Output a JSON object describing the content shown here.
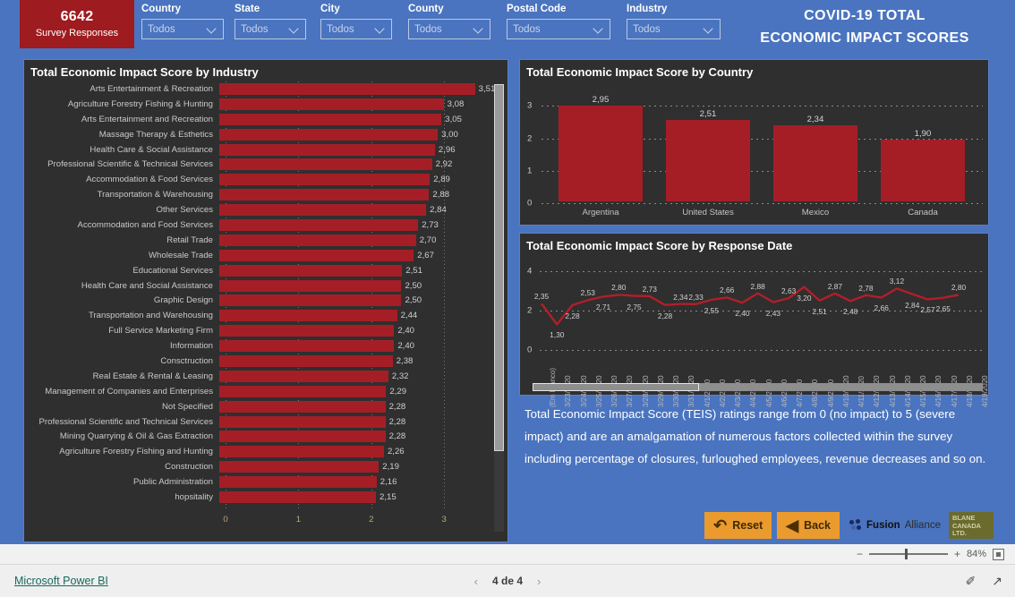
{
  "header": {
    "kpi": {
      "value": "6642",
      "label": "Survey Responses"
    },
    "slicers": [
      {
        "title": "Country",
        "value": "Todos",
        "icon": "chevron-down-icon"
      },
      {
        "title": "State",
        "value": "Todos",
        "icon": "chevron-down-icon"
      },
      {
        "title": "City",
        "value": "Todos",
        "icon": "chevron-down-icon"
      },
      {
        "title": "County",
        "value": "Todos",
        "icon": "chevron-down-icon"
      },
      {
        "title": "Postal Code",
        "value": "Todos",
        "icon": "chevron-down-icon"
      },
      {
        "title": "Industry",
        "value": "Todos",
        "icon": "chevron-down-icon"
      }
    ],
    "title_line1": "COVID-19 TOTAL",
    "title_line2": "ECONOMIC IMPACT SCORES"
  },
  "colors": {
    "canvas": "#4a74bf",
    "panel": "#2f2f2f",
    "bar": "#a51e26",
    "kpi": "#9e1b1f",
    "accent_button": "#eb9b2d"
  },
  "description": "Total Economic Impact Score (TEIS) ratings range from 0 (no impact) to 5 (severe impact) and are an amalgamation of numerous factors collected within the survey including percentage of closures, furloughed employees, revenue decreases and so on.",
  "actions": {
    "reset_label": "Reset",
    "reset_icon": "undo-arrow-icon",
    "back_label": "Back",
    "back_icon": "back-circle-arrow-icon",
    "fusion_name": "Fusion",
    "fusion_sub": "Alliance",
    "blane_line1": "BLANE",
    "blane_line2": "CANADA",
    "blane_line3": "LTD."
  },
  "zoombar": {
    "minus": "−",
    "plus": "+",
    "percent": "84%",
    "fit_icon": "fit-to-page-icon"
  },
  "statusbar": {
    "link": "Microsoft Power BI",
    "prev_icon": "chevron-left-icon",
    "next_icon": "chevron-right-icon",
    "page": "4 de 4",
    "icons": [
      {
        "name": "edit-page-icon",
        "glyph": "✐"
      },
      {
        "name": "fullscreen-icon",
        "glyph": "↗"
      }
    ]
  },
  "chart_data": [
    {
      "type": "bar",
      "title": "Total Economic Impact Score by Industry",
      "orientation": "horizontal",
      "xlabel": "",
      "ylabel": "",
      "xlim": [
        0,
        3.6
      ],
      "xticks": [
        "0",
        "1",
        "2",
        "3"
      ],
      "grid": true,
      "categories": [
        "Arts Entertainment & Recreation",
        "Agriculture Forestry Fishing & Hunting",
        "Arts Entertainment and Recreation",
        "Massage Therapy & Esthetics",
        "Health Care & Social Assistance",
        "Professional Scientific & Technical Services",
        "Accommodation & Food Services",
        "Transportation & Warehousing",
        "Other Services",
        "Accommodation and Food Services",
        "Retail Trade",
        "Wholesale Trade",
        "Educational Services",
        "Health Care and Social Assistance",
        "Graphic Design",
        "Transportation and Warehousing",
        "Full Service Marketing Firm",
        "Information",
        "Consctruction",
        "Real Estate & Rental & Leasing",
        "Management of Companies and Enterprises",
        "Not Specified",
        "Professional Scientific and Technical Services",
        "Mining Quarrying & Oil & Gas Extraction",
        "Agriculture Forestry Fishing and Hunting",
        "Construction",
        "Public Administration",
        "hopsitality"
      ],
      "values": [
        3.51,
        3.08,
        3.05,
        3.0,
        2.96,
        2.92,
        2.89,
        2.88,
        2.84,
        2.73,
        2.7,
        2.67,
        2.51,
        2.5,
        2.5,
        2.44,
        2.4,
        2.4,
        2.38,
        2.32,
        2.29,
        2.28,
        2.28,
        2.28,
        2.26,
        2.19,
        2.16,
        2.15
      ],
      "labels": [
        "3,51",
        "3,08",
        "3,05",
        "3,00",
        "2,96",
        "2,92",
        "2,89",
        "2,88",
        "2,84",
        "2,73",
        "2,70",
        "2,67",
        "2,51",
        "2,50",
        "2,50",
        "2,44",
        "2,40",
        "2,40",
        "2,38",
        "2,32",
        "2,29",
        "2,28",
        "2,28",
        "2,28",
        "2,26",
        "2,19",
        "2,16",
        "2,15"
      ]
    },
    {
      "type": "bar",
      "title": "Total Economic Impact Score by Country",
      "orientation": "vertical",
      "categories": [
        "Argentina",
        "United States",
        "Mexico",
        "Canada"
      ],
      "values": [
        2.95,
        2.51,
        2.34,
        1.9
      ],
      "labels": [
        "2,95",
        "2,51",
        "2,34",
        "1,90"
      ],
      "ylim": [
        0,
        3.2
      ],
      "yticks": [
        "0",
        "1",
        "2",
        "3"
      ],
      "grid": true,
      "xlabel": "",
      "ylabel": ""
    },
    {
      "type": "line",
      "title": "Total Economic Impact Score by Response Date",
      "ylim": [
        0,
        4
      ],
      "yticks": [
        "0",
        "2",
        "4"
      ],
      "grid": true,
      "xlabel": "",
      "ylabel": "",
      "x": [
        "(Em branco)",
        "3/23/2020",
        "3/24/2020",
        "3/25/2020",
        "3/26/2020",
        "3/27/2020",
        "3/28/2020",
        "3/29/2020",
        "3/30/2020",
        "3/31/2020",
        "4/1/2020",
        "4/2/2020",
        "4/3/2020",
        "4/4/2020",
        "4/5/2020",
        "4/6/2020",
        "4/7/2020",
        "4/8/2020",
        "4/9/2020",
        "4/10/2020",
        "4/11/2020",
        "4/12/2020",
        "4/13/2020",
        "4/14/2020",
        "4/15/2020",
        "4/16/2020",
        "4/17/2020",
        "4/18/2020",
        "4/19/2020"
      ],
      "values": [
        2.35,
        1.3,
        2.28,
        2.53,
        2.71,
        2.8,
        2.75,
        2.73,
        2.28,
        2.34,
        2.33,
        2.55,
        2.66,
        2.4,
        2.88,
        2.43,
        2.63,
        3.2,
        2.51,
        2.87,
        2.48,
        2.78,
        2.66,
        3.12,
        2.84,
        2.57,
        2.65,
        2.8
      ],
      "labels": [
        "2,35",
        "1,30",
        "2,28",
        "2,53",
        "2,71",
        "2,80",
        "2,75",
        "2,73",
        "2,28",
        "2,34",
        "2,33",
        "2,55",
        "2,66",
        "2,40",
        "2,88",
        "2,43",
        "2,63",
        "3,20",
        "2,51",
        "2,87",
        "2,48",
        "2,78",
        "2,66",
        "3,12",
        "2,84",
        "2,57",
        "2,65",
        "2,80"
      ],
      "label_above": [
        true,
        false,
        false,
        true,
        false,
        true,
        false,
        true,
        false,
        true,
        true,
        false,
        true,
        false,
        true,
        false,
        true,
        false,
        false,
        true,
        false,
        true,
        false,
        true,
        false,
        false,
        false,
        true
      ],
      "series_color": "#b11f28"
    }
  ]
}
